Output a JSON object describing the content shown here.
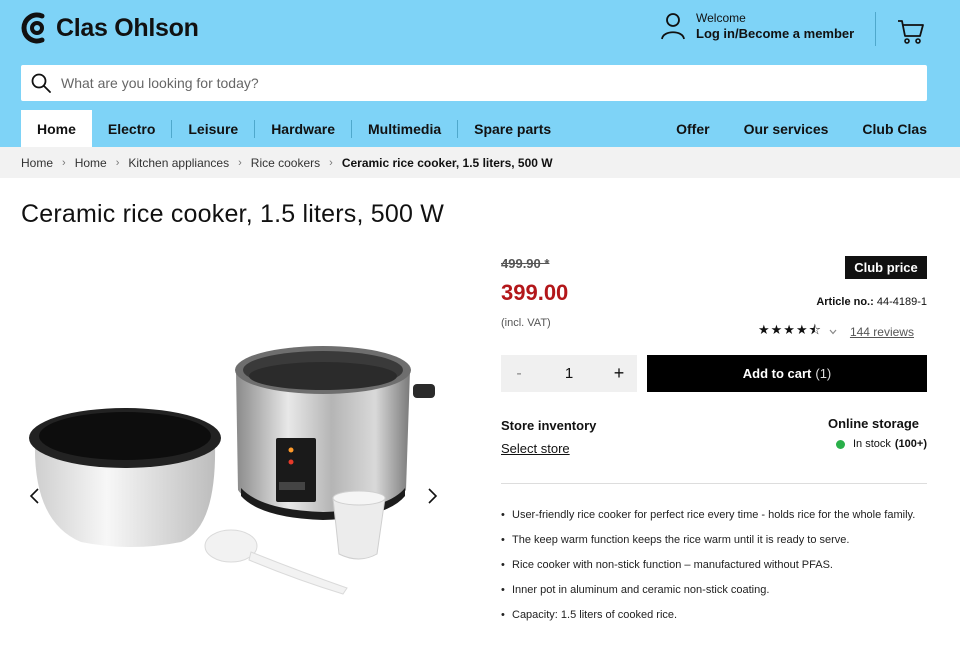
{
  "brand": {
    "name": "Clas Ohlson"
  },
  "account": {
    "welcome": "Welcome",
    "login": "Log in/Become a member"
  },
  "search": {
    "placeholder": "What are you looking for today?"
  },
  "nav": {
    "left": [
      "Home",
      "Electro",
      "Leisure",
      "Hardware",
      "Multimedia",
      "Spare parts"
    ],
    "right": [
      "Offer",
      "Our services",
      "Club Clas"
    ],
    "active": "Home"
  },
  "breadcrumb": [
    "Home",
    "Home",
    "Kitchen appliances",
    "Rice cookers",
    "Ceramic rice cooker, 1.5 liters, 500 W"
  ],
  "product": {
    "title": "Ceramic rice cooker, 1.5 liters, 500 W",
    "old_price": "499.90 *",
    "price": "399.00",
    "vat_note": "(incl. VAT)",
    "club_badge": "Club price",
    "article_label": "Article no.:",
    "article_number": "44-4189-1",
    "rating": 4.5,
    "reviews": "144 reviews",
    "quantity": "1",
    "qty_minus": "-",
    "qty_plus": "+",
    "add_to_cart": "Add to cart",
    "cart_count": "(1)"
  },
  "inventory": {
    "store_title": "Store inventory",
    "select_store": "Select store",
    "online_title": "Online storage",
    "stock_text": "In stock",
    "stock_count": "(100+)",
    "stock_color": "#2ab04a"
  },
  "features": [
    "User-friendly rice cooker for perfect rice every time - holds rice for the whole family.",
    "The keep warm function keeps the rice warm until it is ready to serve.",
    "Rice cooker with non-stick function – manufactured without PFAS.",
    "Inner pot in aluminum and ceramic non-stick coating.",
    "Capacity: 1.5 liters of cooked rice."
  ],
  "colors": {
    "header": "#7ed3f7",
    "price": "#b3171a",
    "cta": "#000000"
  },
  "icons": [
    "logo-icon",
    "user-icon",
    "cart-icon",
    "search-icon",
    "chevron-right-icon",
    "chevron-left-icon",
    "star-icon"
  ]
}
